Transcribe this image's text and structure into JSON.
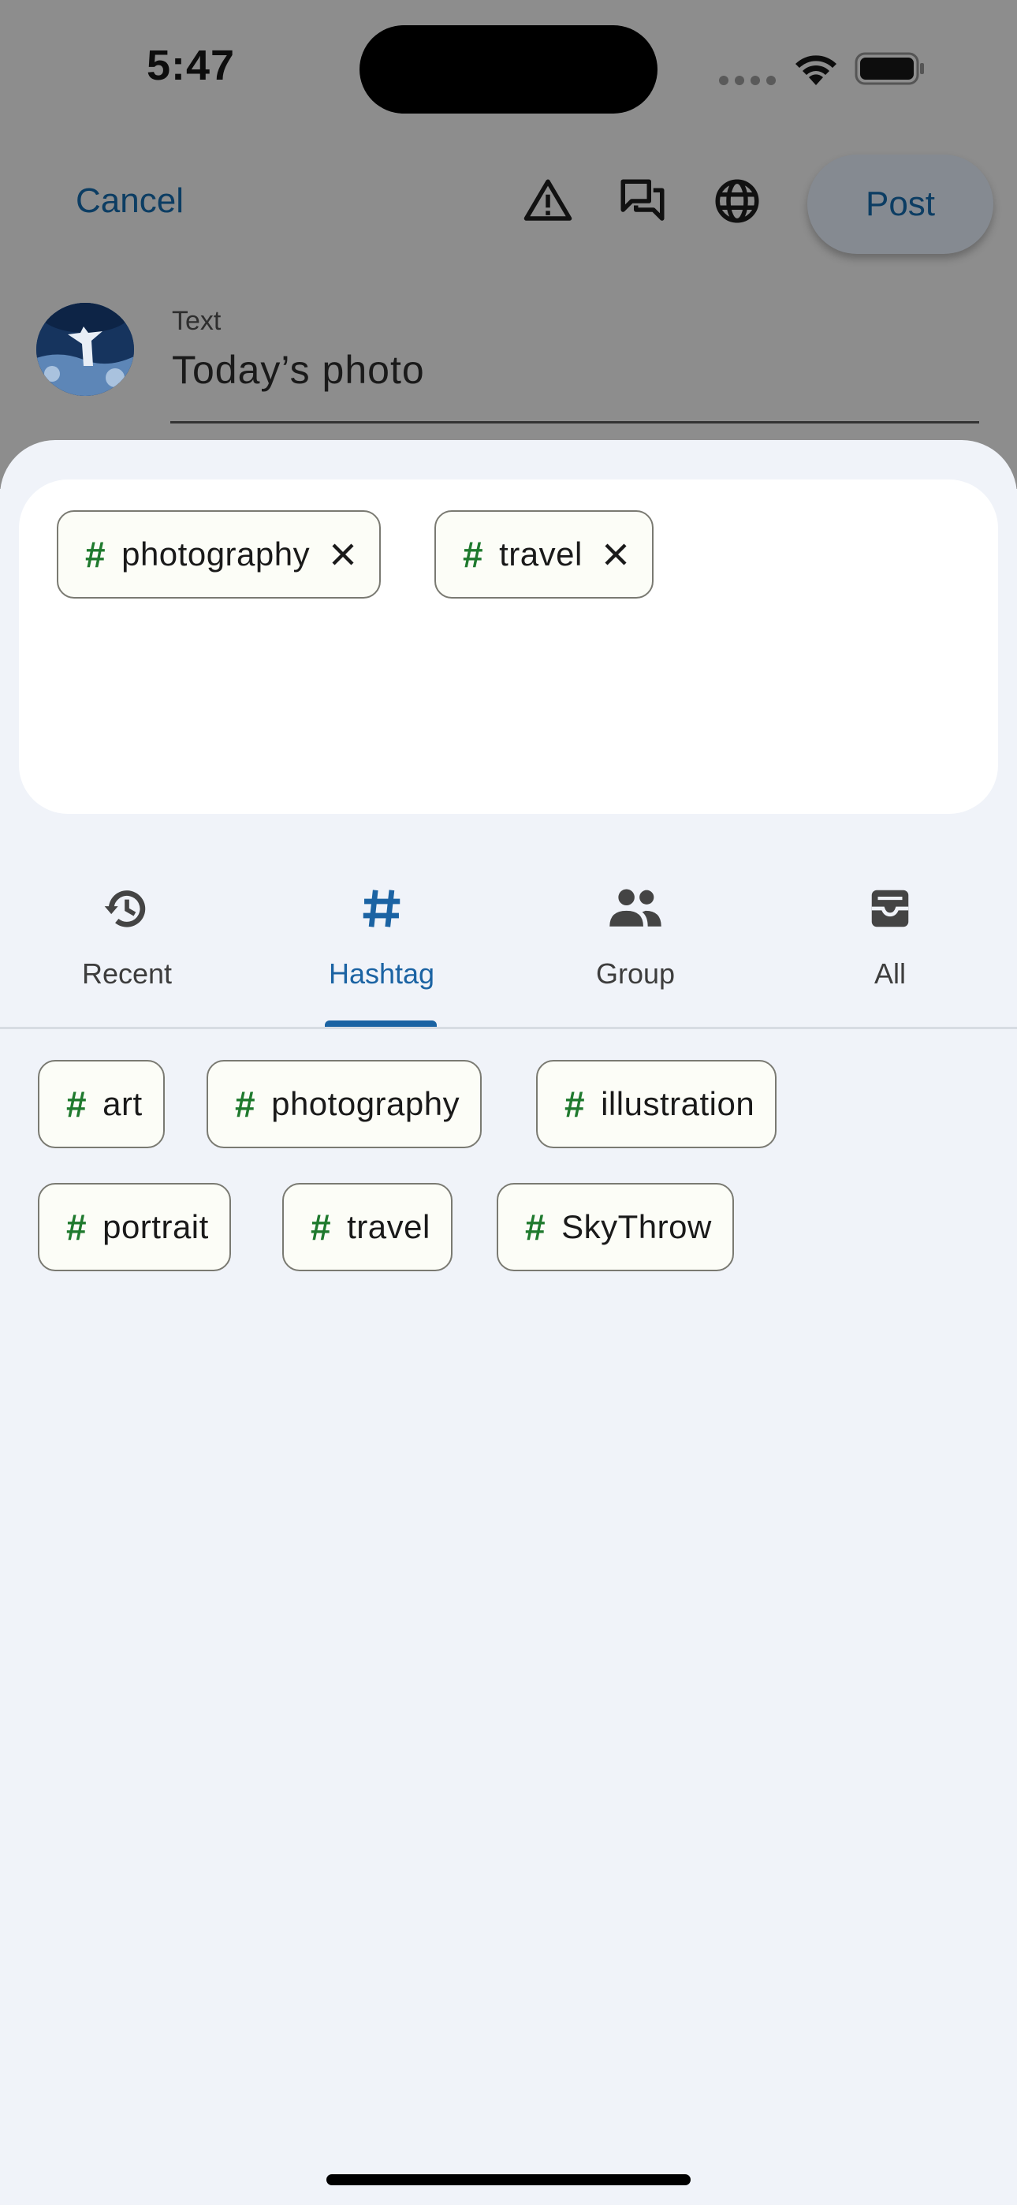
{
  "status_bar": {
    "time": "5:47"
  },
  "header": {
    "cancel_label": "Cancel",
    "icons": [
      "warning-icon",
      "chat-icon",
      "globe-icon"
    ],
    "post_label": "Post"
  },
  "compose": {
    "field_label": "Text",
    "field_value": "Today’s photo"
  },
  "selected_tags": [
    {
      "label": "photography"
    },
    {
      "label": "travel"
    }
  ],
  "tabs": [
    {
      "label": "Recent",
      "icon": "history-icon"
    },
    {
      "label": "Hashtag",
      "icon": "hashtag-icon",
      "active": true
    },
    {
      "label": "Group",
      "icon": "group-icon"
    },
    {
      "label": "All",
      "icon": "inbox-icon"
    }
  ],
  "suggested_tags": [
    {
      "label": "art"
    },
    {
      "label": "photography"
    },
    {
      "label": "illustration"
    },
    {
      "label": "portrait"
    },
    {
      "label": "travel"
    },
    {
      "label": "SkyThrow"
    }
  ],
  "colors": {
    "accent": "#1b63a3",
    "hashtag": "#1f7a2e",
    "sheet_bg": "#f0f3f9",
    "chip_bg": "#fcfdf7"
  }
}
